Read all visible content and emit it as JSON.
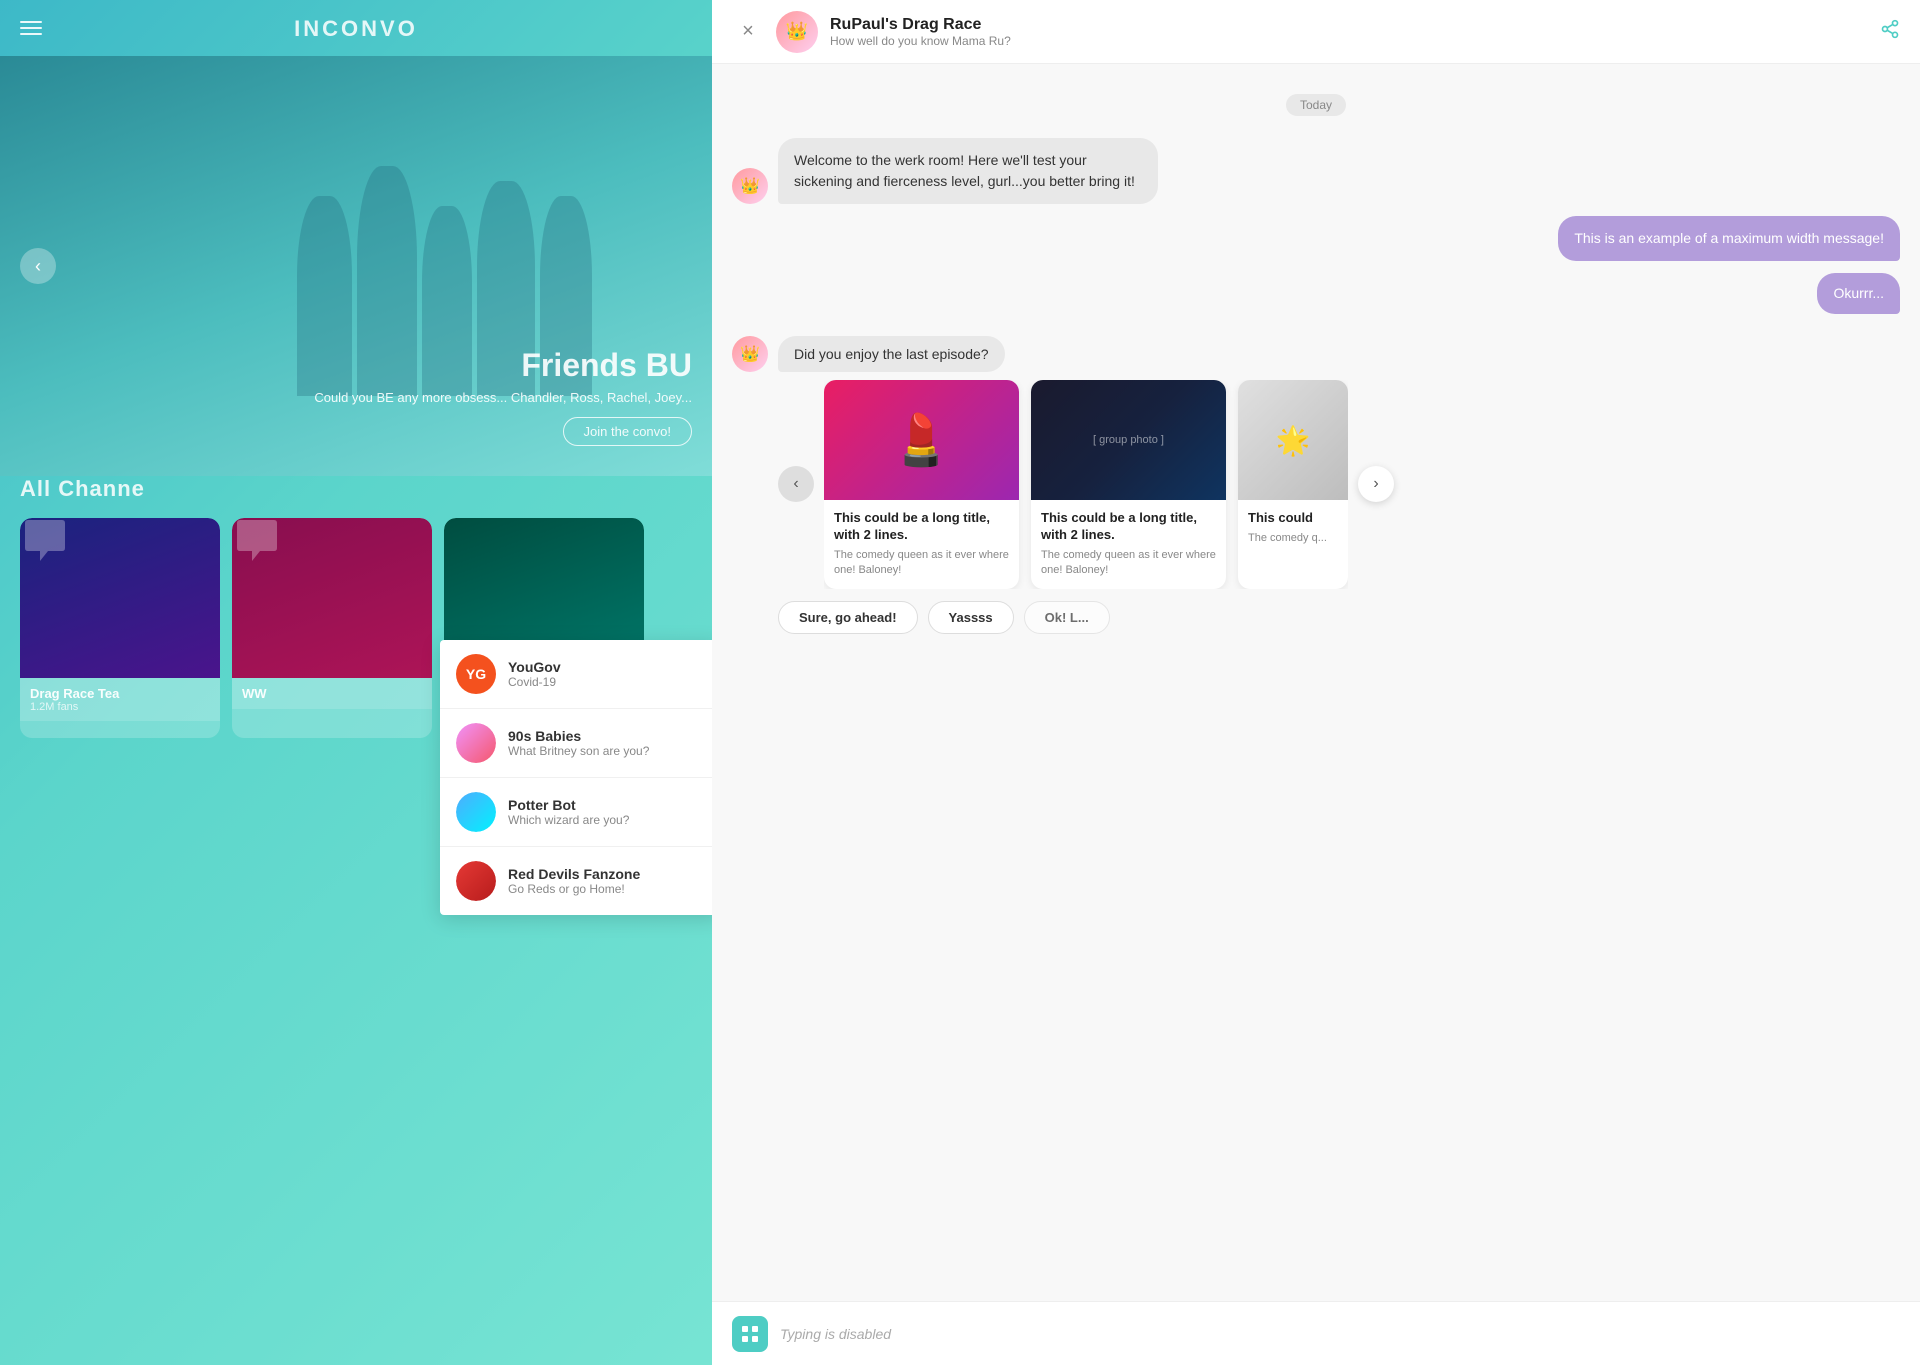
{
  "app": {
    "title": "INCONVO",
    "menu_icon": "hamburger"
  },
  "left": {
    "hero": {
      "title": "Friends BU",
      "subtitle": "Could you BE any more obsess... Chandler, Ross, Rachel, Joey...",
      "join_label": "Join the convo!",
      "prev_arrow": "‹"
    },
    "channels": {
      "title": "All Channe",
      "items": [
        {
          "name": "Drag Race Tea",
          "meta": "1.2M fans",
          "color": "#1a237e"
        },
        {
          "name": "WW",
          "meta": "",
          "color": "#880e4f"
        },
        {
          "name": "",
          "meta": "",
          "color": "#004d40"
        }
      ]
    },
    "dropdown": {
      "items": [
        {
          "initials": "YG",
          "bg": "#f4511e",
          "name": "YouGov",
          "sub": "Covid-19"
        },
        {
          "initials": "",
          "name": "90s Babies",
          "sub": "What Britney son are you?",
          "avatar": true
        },
        {
          "initials": "",
          "name": "Potter Bot",
          "sub": "Which wizard are you?",
          "avatar": true
        },
        {
          "initials": "",
          "name": "Red Devils Fanzone",
          "sub": "Go Reds or go Home!",
          "avatar": true
        }
      ]
    }
  },
  "chat": {
    "header": {
      "title": "RuPaul's Drag Race",
      "subtitle": "How well do you know Mama Ru?",
      "close_icon": "×",
      "share_icon": "share"
    },
    "date_separator": "Today",
    "messages": [
      {
        "type": "received",
        "text": "Welcome to the werk room! Here we'll test your sickening and fierceness level, gurl...you better bring it!"
      },
      {
        "type": "sent",
        "text": "This is an example of a maximum width message!"
      },
      {
        "type": "sent",
        "text": "Okurrr..."
      }
    ],
    "carousel": {
      "question": "Did you enjoy the last episode?",
      "cards": [
        {
          "title": "This could be a long title, with 2 lines.",
          "desc": "The comedy queen as it ever where one! Baloney!",
          "img_type": "drag"
        },
        {
          "title": "This could be a long title, with 2 lines.",
          "desc": "The comedy queen as it ever where one! Baloney!",
          "img_type": "friends"
        },
        {
          "title": "This could",
          "desc": "The comedy q... where one! Ba...",
          "img_type": "partial"
        }
      ]
    },
    "quick_replies": [
      {
        "label": "Sure, go ahead!",
        "partial": false
      },
      {
        "label": "Yassss",
        "partial": false
      },
      {
        "label": "Ok! L...",
        "partial": true
      }
    ],
    "input": {
      "placeholder": "Typing is disabled",
      "grid_icon": "grid"
    }
  }
}
